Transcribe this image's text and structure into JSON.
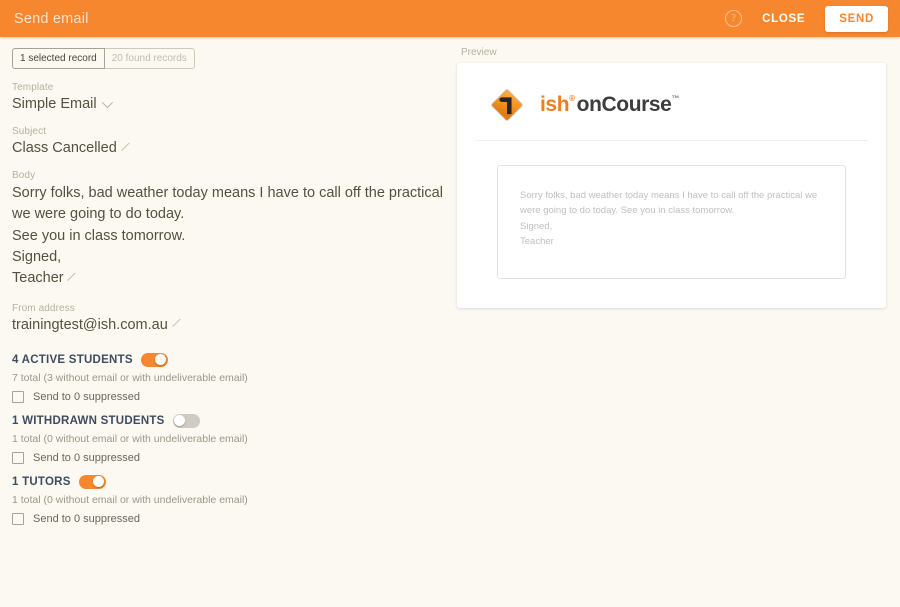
{
  "header": {
    "title": "Send email",
    "help_icon": "help-circle-icon",
    "close_label": "CLOSE",
    "send_label": "SEND",
    "background_color": "#F7872E",
    "send_text_color": "#F7872E"
  },
  "chips": [
    {
      "label": "1 selected record",
      "active": true
    },
    {
      "label": "20 found records",
      "active": false
    }
  ],
  "form": {
    "template": {
      "label": "Template",
      "value": "Simple Email"
    },
    "subject": {
      "label": "Subject",
      "value": "Class Cancelled"
    },
    "body": {
      "label": "Body",
      "lines": [
        "Sorry folks, bad weather today means I have to call off the practical we were going to do today.",
        "See you in class tomorrow.",
        "Signed,",
        "Teacher"
      ]
    },
    "from_address": {
      "label": "From address",
      "value": "trainingtest@ish.com.au"
    }
  },
  "groups": [
    {
      "title": "4 ACTIVE STUDENTS",
      "toggle_on": true,
      "summary": "7 total (3 without email or with undeliverable email)",
      "checkbox_label": "Send to 0 suppressed",
      "checked": false
    },
    {
      "title": "1 WITHDRAWN STUDENTS",
      "toggle_on": false,
      "summary": "1 total (0 without email or with undeliverable email)",
      "checkbox_label": "Send to 0 suppressed",
      "checked": false
    },
    {
      "title": "1 TUTORS",
      "toggle_on": true,
      "summary": "1 total (0 without email or with undeliverable email)",
      "checkbox_label": "Send to 0 suppressed",
      "checked": false
    }
  ],
  "preview": {
    "label": "Preview",
    "logo": {
      "mark": "ish-oncourse-diamond-logo-icon",
      "word_primary": "ish",
      "word_primary_sup": "®",
      "word_secondary": "onCourse",
      "word_secondary_sup": "™",
      "primary_color": "#F07D1E",
      "secondary_color": "#3D3D3D"
    },
    "body_lines": [
      "Sorry folks, bad weather today means I have to call off the practical we were going to do today. See you in class tomorrow.",
      "Signed,",
      "Teacher"
    ]
  },
  "theme": {
    "page_background": "#FBF9F1",
    "accent": "#F7872E",
    "group_title_color": "#3E4C61"
  }
}
